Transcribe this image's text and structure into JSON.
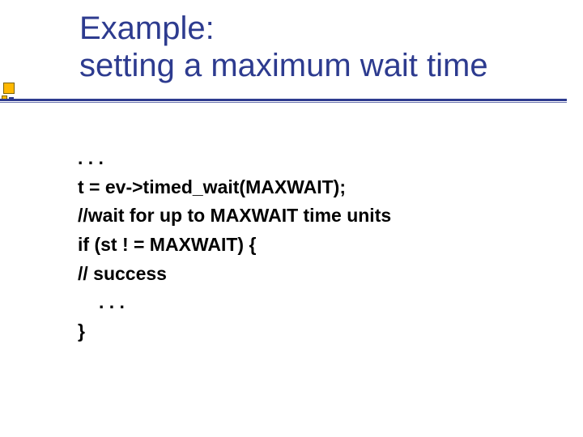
{
  "title_line1": "Example:",
  "title_line2": "setting a maximum wait time",
  "code": {
    "l1": ". . .",
    "l2": "t = ev->timed_wait(MAXWAIT);",
    "l3": "//wait for up to MAXWAIT time units",
    "l4": "if (st ! = MAXWAIT) {",
    "l5": "// success",
    "l6": ". . .",
    "l7": "}"
  }
}
